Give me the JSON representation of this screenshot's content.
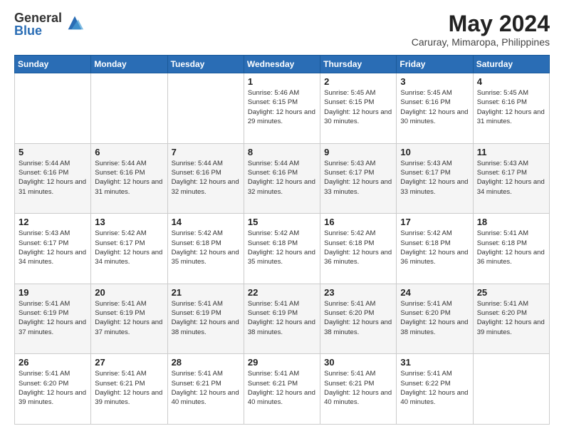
{
  "logo": {
    "general": "General",
    "blue": "Blue"
  },
  "title": "May 2024",
  "subtitle": "Caruray, Mimaropa, Philippines",
  "days_of_week": [
    "Sunday",
    "Monday",
    "Tuesday",
    "Wednesday",
    "Thursday",
    "Friday",
    "Saturday"
  ],
  "weeks": [
    [
      {
        "day": "",
        "info": ""
      },
      {
        "day": "",
        "info": ""
      },
      {
        "day": "",
        "info": ""
      },
      {
        "day": "1",
        "info": "Sunrise: 5:46 AM\nSunset: 6:15 PM\nDaylight: 12 hours\nand 29 minutes."
      },
      {
        "day": "2",
        "info": "Sunrise: 5:45 AM\nSunset: 6:15 PM\nDaylight: 12 hours\nand 30 minutes."
      },
      {
        "day": "3",
        "info": "Sunrise: 5:45 AM\nSunset: 6:16 PM\nDaylight: 12 hours\nand 30 minutes."
      },
      {
        "day": "4",
        "info": "Sunrise: 5:45 AM\nSunset: 6:16 PM\nDaylight: 12 hours\nand 31 minutes."
      }
    ],
    [
      {
        "day": "5",
        "info": "Sunrise: 5:44 AM\nSunset: 6:16 PM\nDaylight: 12 hours\nand 31 minutes."
      },
      {
        "day": "6",
        "info": "Sunrise: 5:44 AM\nSunset: 6:16 PM\nDaylight: 12 hours\nand 31 minutes."
      },
      {
        "day": "7",
        "info": "Sunrise: 5:44 AM\nSunset: 6:16 PM\nDaylight: 12 hours\nand 32 minutes."
      },
      {
        "day": "8",
        "info": "Sunrise: 5:44 AM\nSunset: 6:16 PM\nDaylight: 12 hours\nand 32 minutes."
      },
      {
        "day": "9",
        "info": "Sunrise: 5:43 AM\nSunset: 6:17 PM\nDaylight: 12 hours\nand 33 minutes."
      },
      {
        "day": "10",
        "info": "Sunrise: 5:43 AM\nSunset: 6:17 PM\nDaylight: 12 hours\nand 33 minutes."
      },
      {
        "day": "11",
        "info": "Sunrise: 5:43 AM\nSunset: 6:17 PM\nDaylight: 12 hours\nand 34 minutes."
      }
    ],
    [
      {
        "day": "12",
        "info": "Sunrise: 5:43 AM\nSunset: 6:17 PM\nDaylight: 12 hours\nand 34 minutes."
      },
      {
        "day": "13",
        "info": "Sunrise: 5:42 AM\nSunset: 6:17 PM\nDaylight: 12 hours\nand 34 minutes."
      },
      {
        "day": "14",
        "info": "Sunrise: 5:42 AM\nSunset: 6:18 PM\nDaylight: 12 hours\nand 35 minutes."
      },
      {
        "day": "15",
        "info": "Sunrise: 5:42 AM\nSunset: 6:18 PM\nDaylight: 12 hours\nand 35 minutes."
      },
      {
        "day": "16",
        "info": "Sunrise: 5:42 AM\nSunset: 6:18 PM\nDaylight: 12 hours\nand 36 minutes."
      },
      {
        "day": "17",
        "info": "Sunrise: 5:42 AM\nSunset: 6:18 PM\nDaylight: 12 hours\nand 36 minutes."
      },
      {
        "day": "18",
        "info": "Sunrise: 5:41 AM\nSunset: 6:18 PM\nDaylight: 12 hours\nand 36 minutes."
      }
    ],
    [
      {
        "day": "19",
        "info": "Sunrise: 5:41 AM\nSunset: 6:19 PM\nDaylight: 12 hours\nand 37 minutes."
      },
      {
        "day": "20",
        "info": "Sunrise: 5:41 AM\nSunset: 6:19 PM\nDaylight: 12 hours\nand 37 minutes."
      },
      {
        "day": "21",
        "info": "Sunrise: 5:41 AM\nSunset: 6:19 PM\nDaylight: 12 hours\nand 38 minutes."
      },
      {
        "day": "22",
        "info": "Sunrise: 5:41 AM\nSunset: 6:19 PM\nDaylight: 12 hours\nand 38 minutes."
      },
      {
        "day": "23",
        "info": "Sunrise: 5:41 AM\nSunset: 6:20 PM\nDaylight: 12 hours\nand 38 minutes."
      },
      {
        "day": "24",
        "info": "Sunrise: 5:41 AM\nSunset: 6:20 PM\nDaylight: 12 hours\nand 38 minutes."
      },
      {
        "day": "25",
        "info": "Sunrise: 5:41 AM\nSunset: 6:20 PM\nDaylight: 12 hours\nand 39 minutes."
      }
    ],
    [
      {
        "day": "26",
        "info": "Sunrise: 5:41 AM\nSunset: 6:20 PM\nDaylight: 12 hours\nand 39 minutes."
      },
      {
        "day": "27",
        "info": "Sunrise: 5:41 AM\nSunset: 6:21 PM\nDaylight: 12 hours\nand 39 minutes."
      },
      {
        "day": "28",
        "info": "Sunrise: 5:41 AM\nSunset: 6:21 PM\nDaylight: 12 hours\nand 40 minutes."
      },
      {
        "day": "29",
        "info": "Sunrise: 5:41 AM\nSunset: 6:21 PM\nDaylight: 12 hours\nand 40 minutes."
      },
      {
        "day": "30",
        "info": "Sunrise: 5:41 AM\nSunset: 6:21 PM\nDaylight: 12 hours\nand 40 minutes."
      },
      {
        "day": "31",
        "info": "Sunrise: 5:41 AM\nSunset: 6:22 PM\nDaylight: 12 hours\nand 40 minutes."
      },
      {
        "day": "",
        "info": ""
      }
    ]
  ]
}
